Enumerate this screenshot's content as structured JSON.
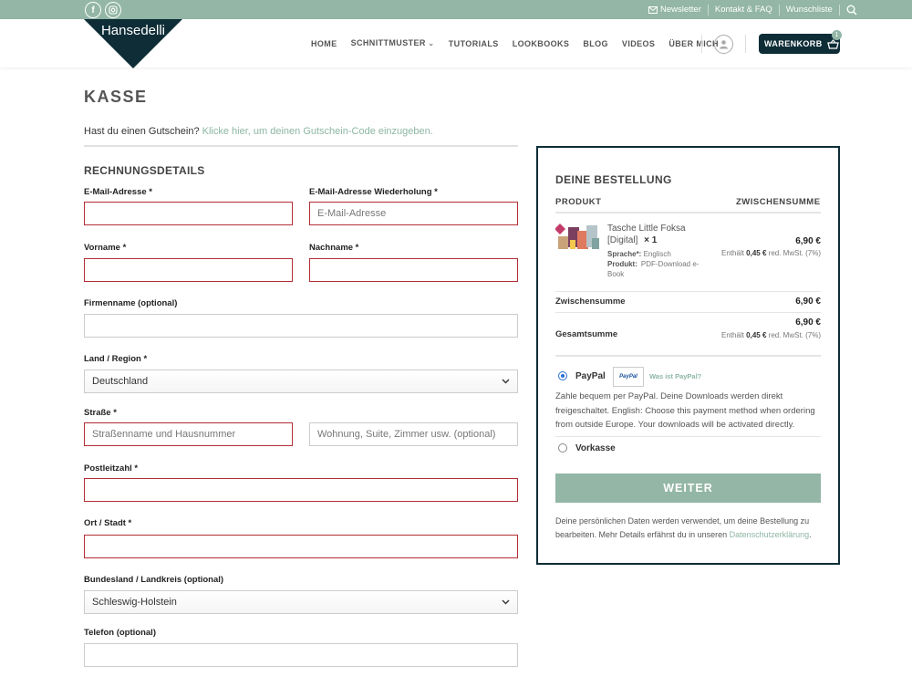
{
  "topbar": {
    "links": [
      "Newsletter",
      "Kontakt & FAQ",
      "Wunschliste"
    ]
  },
  "logo": {
    "text": "Hansedelli"
  },
  "nav": {
    "items": [
      "HOME",
      "SCHNITTMUSTER",
      "TUTORIALS",
      "LOOKBOOKS",
      "BLOG",
      "VIDEOS",
      "ÜBER MICH"
    ],
    "cart_label": "WARENKORB",
    "cart_count": "1"
  },
  "page": {
    "title": "KASSE",
    "coupon_text": "Hast du einen Gutschein?",
    "coupon_link": "Klicke hier, um deinen Gutschein-Code einzugeben.",
    "billing_title": "RECHNUNGSDETAILS"
  },
  "form": {
    "email_label": "E-Mail-Adresse *",
    "email_repeat_label": "E-Mail-Adresse Wiederholung  *",
    "email_repeat_placeholder": "E-Mail-Adresse",
    "firstname_label": "Vorname *",
    "lastname_label": "Nachname *",
    "company_label": "Firmenname (optional)",
    "country_label": "Land / Region *",
    "country_value": "Deutschland",
    "street_label": "Straße *",
    "street_placeholder": "Straßenname und Hausnummer",
    "street2_placeholder": "Wohnung, Suite, Zimmer usw. (optional)",
    "zip_label": "Postleitzahl *",
    "city_label": "Ort / Stadt *",
    "state_label": "Bundesland / Landkreis (optional)",
    "state_value": "Schleswig-Holstein",
    "phone_label": "Telefon (optional)"
  },
  "order": {
    "title": "DEINE BESTELLUNG",
    "col_product": "PRODUKT",
    "col_subtotal": "ZWISCHENSUMME",
    "product_name": "Tasche Little Foksa [Digital]",
    "product_qty": "× 1",
    "meta_lang_key": "Sprache*:",
    "meta_lang_val": "Englisch",
    "meta_prod_key": "Produkt:",
    "meta_prod_val": "PDF-Download e-Book",
    "line_price": "6,90 €",
    "tax_prefix": "Enthält",
    "tax_amount": "0,45 €",
    "tax_suffix": "red. MwSt. (7%)",
    "subtotal_label": "Zwischensumme",
    "subtotal_value": "6,90 €",
    "total_label": "Gesamtsumme",
    "total_value": "6,90 €",
    "total_tax_prefix": "Enthält",
    "total_tax_amount": "0,45 €",
    "total_tax_suffix": "red. MwSt. (7%)"
  },
  "payment": {
    "paypal_label": "PayPal",
    "paypal_logo": "PayPal",
    "paypal_what": "Was ist PayPal?",
    "paypal_desc": "Zahle bequem per PayPal. Deine Downloads werden direkt freigeschaltet. English: Choose this payment method when ordering from outside Europe. Your downloads will be activated directly.",
    "vorkasse_label": "Vorkasse",
    "submit_label": "WEITER",
    "privacy_text": "Deine persönlichen Daten werden verwendet, um deine Bestellung zu bearbeiten. Mehr Details erfährst du in unseren",
    "privacy_link": "Datenschutzerklärung",
    "privacy_end": "."
  },
  "colors": {
    "accent": "#93b6a6",
    "dark": "#0e2d37",
    "error": "#b22e35"
  },
  "icons": [
    "facebook-icon",
    "instagram-icon",
    "mail-icon",
    "search-icon",
    "user-icon",
    "basket-icon",
    "chevron-down-icon"
  ]
}
